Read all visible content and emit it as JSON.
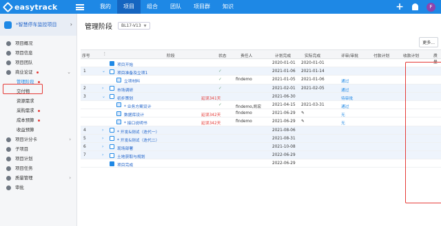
{
  "app": {
    "name": "easytrack"
  },
  "nav": {
    "items": [
      "我的",
      "项目",
      "组合",
      "团队",
      "项目群",
      "知识"
    ],
    "active": 1
  },
  "user": {
    "avatar_letter": "F"
  },
  "project": {
    "name": "*智慧停车监控项目"
  },
  "sidebar": {
    "items": [
      {
        "label": "项目概况",
        "icon": "info-icon",
        "sub": false
      },
      {
        "label": "项目信息",
        "icon": "info-icon",
        "sub": false
      },
      {
        "label": "项目团队",
        "icon": "team-icon",
        "sub": false
      },
      {
        "label": "商业论证",
        "icon": "flag-icon",
        "sub": false,
        "dot": true,
        "caret": "⌄"
      },
      {
        "label": "管理阶段",
        "icon": "",
        "sub": true,
        "dot": true,
        "active": true
      },
      {
        "label": "交付物",
        "icon": "",
        "sub": true
      },
      {
        "label": "资源需求",
        "icon": "",
        "sub": true
      },
      {
        "label": "采购需求",
        "icon": "",
        "sub": true,
        "dot": true
      },
      {
        "label": "成本预算",
        "icon": "",
        "sub": true,
        "dot": true
      },
      {
        "label": "收益预算",
        "icon": "",
        "sub": true
      },
      {
        "label": "项目计分卡",
        "icon": "scorecard-icon",
        "sub": false,
        "caret": "›"
      },
      {
        "label": "子项目",
        "icon": "subproject-icon",
        "sub": false
      },
      {
        "label": "项目计划",
        "icon": "plan-icon",
        "sub": false
      },
      {
        "label": "项目任务",
        "icon": "task-icon",
        "sub": false
      },
      {
        "label": "质量管理",
        "icon": "quality-icon",
        "sub": false,
        "caret": "›"
      },
      {
        "label": "审批",
        "icon": "approve-icon",
        "sub": false
      }
    ]
  },
  "page": {
    "title": "管理阶段",
    "version": "BL17-V13",
    "more_button": "更多..."
  },
  "table": {
    "headers": {
      "num": "序号",
      "stage": "阶段",
      "status": "状态",
      "owner": "责任人",
      "plan_done": "计划完成",
      "actual_done": "实际完成",
      "review": "评审/审批",
      "pay_plan": "付款计划",
      "receive_plan": "收款计划",
      "quality": "质量"
    },
    "rows": [
      {
        "num": "",
        "exp": "",
        "icon": "flag",
        "name": "项目开始",
        "status": "",
        "owner": "",
        "plan": "2020-01-01",
        "actual": "2020-01-01",
        "review": "",
        "shaded": false,
        "indent": 0
      },
      {
        "num": "1",
        "exp": "⌄",
        "icon": "task",
        "name": "项目准备及立项1",
        "status": "✓",
        "owner": "",
        "plan": "2021-01-06",
        "actual": "2021-01-14",
        "review": "",
        "shaded": true,
        "indent": 0
      },
      {
        "num": "",
        "exp": "",
        "icon": "doc",
        "name": "立项材料",
        "status": "✓",
        "owner": "findemo",
        "plan": "2021-01-05",
        "actual": "2021-01-06",
        "review": "通过",
        "shaded": false,
        "indent": 1
      },
      {
        "num": "2",
        "exp": "›",
        "icon": "task",
        "name": "市场调研",
        "status": "✓",
        "owner": "",
        "plan": "2021-02-01",
        "actual": "2021-02-05",
        "review": "通过",
        "shaded": true,
        "indent": 0
      },
      {
        "num": "3",
        "exp": "⌄",
        "icon": "task",
        "name": "初步策划",
        "status": "延误341天",
        "owner": "",
        "plan": "2021-06-30",
        "actual": "",
        "review": "待审批",
        "shaded": true,
        "indent": 0,
        "late": true
      },
      {
        "num": "",
        "exp": "",
        "icon": "doc",
        "name": "* 业务方案设计",
        "status": "✓",
        "owner": "findemo,凯宏",
        "plan": "2021-04-15",
        "actual": "2021-03-31",
        "review": "通过",
        "shaded": false,
        "indent": 1
      },
      {
        "num": "",
        "exp": "",
        "icon": "doc",
        "name": "数据库设计",
        "status": "延误342天",
        "owner": "findemo",
        "plan": "2021-06-29",
        "actual": "✎",
        "review": "无",
        "shaded": false,
        "indent": 1,
        "late": true
      },
      {
        "num": "",
        "exp": "",
        "icon": "doc",
        "name": "* 接口说明书",
        "status": "延误342天",
        "owner": "findemo",
        "plan": "2021-06-29",
        "actual": "✎",
        "review": "无",
        "shaded": false,
        "indent": 1,
        "late": true
      },
      {
        "num": "4",
        "exp": "›",
        "icon": "task",
        "name": "* 开发&测试（迭代一）",
        "status": "",
        "owner": "",
        "plan": "2021-08-06",
        "actual": "",
        "review": "",
        "shaded": true,
        "indent": 0
      },
      {
        "num": "5",
        "exp": "›",
        "icon": "task",
        "name": "* 开发&测试（迭代二）",
        "status": "",
        "owner": "",
        "plan": "2021-08-31",
        "actual": "",
        "review": "",
        "shaded": true,
        "indent": 0
      },
      {
        "num": "6",
        "exp": "›",
        "icon": "task",
        "name": "现场部署",
        "status": "",
        "owner": "",
        "plan": "2021-10-08",
        "actual": "",
        "review": "",
        "shaded": true,
        "indent": 0
      },
      {
        "num": "7",
        "exp": "›",
        "icon": "task",
        "name": "土地获取与规划",
        "status": "",
        "owner": "",
        "plan": "2022-06-29",
        "actual": "",
        "review": "",
        "shaded": true,
        "indent": 0
      },
      {
        "num": "",
        "exp": "",
        "icon": "flag",
        "name": "项目完成",
        "status": "",
        "owner": "",
        "plan": "2022-06-29",
        "actual": "",
        "review": "",
        "shaded": false,
        "indent": 0
      }
    ]
  },
  "colors": {
    "primary": "#1e88e5",
    "highlight": "#e53935"
  }
}
